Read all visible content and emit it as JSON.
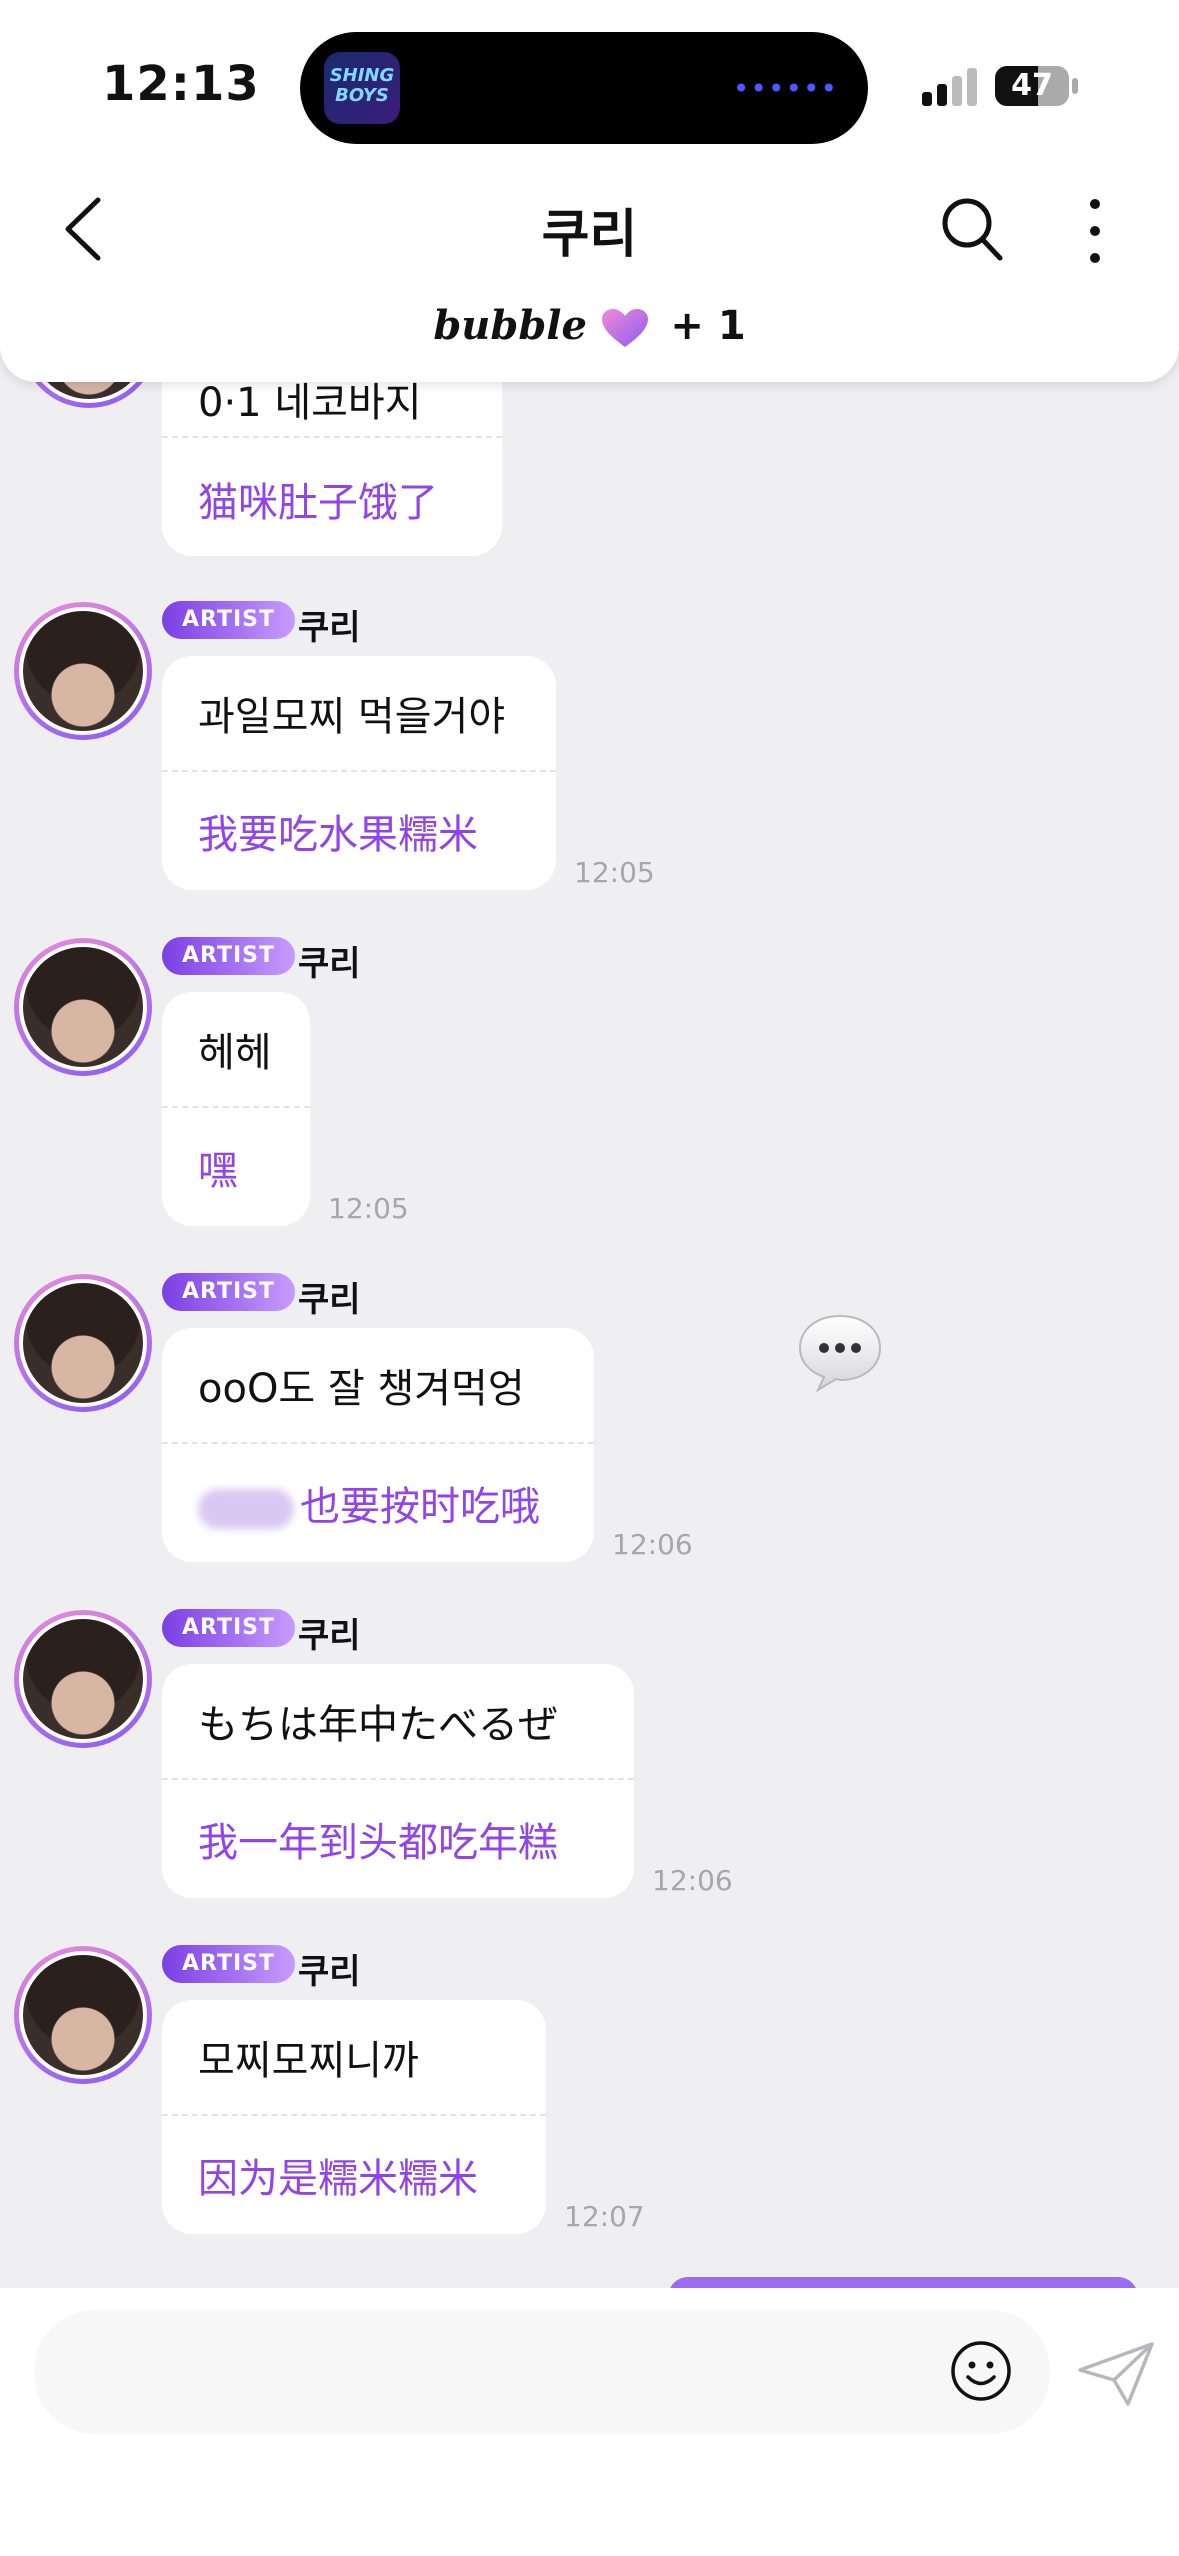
{
  "status_bar": {
    "time": "12:13",
    "battery": "47",
    "island_app": "SHING BOYS"
  },
  "header": {
    "title": "쿠리",
    "bubble_label": "bubble",
    "plus_label": "+ 1"
  },
  "top_partial": {
    "ko": "0·1 네코바지",
    "zh": "猫咪肚子饿了"
  },
  "messages": [
    {
      "badge": "ARTIST",
      "sender": "쿠리",
      "ko": "과일모찌 먹을거야",
      "zh": "我要吃水果糯米",
      "time": "12:05"
    },
    {
      "badge": "ARTIST",
      "sender": "쿠리",
      "ko": "헤헤",
      "zh": "嘿",
      "time": "12:05"
    },
    {
      "badge": "ARTIST",
      "sender": "쿠리",
      "ko": "ooO도 잘 챙겨먹엉",
      "zh": "也要按时吃哦",
      "time": "12:06"
    },
    {
      "badge": "ARTIST",
      "sender": "쿠리",
      "ko": "もちは年中たべるぜ",
      "zh": "我一年到头都吃年糕",
      "time": "12:06"
    },
    {
      "badge": "ARTIST",
      "sender": "쿠리",
      "ko": "모찌모찌니까",
      "zh": "因为是糯米糯米",
      "time": "12:07"
    }
  ],
  "input": {
    "placeholder": ""
  },
  "icons": {
    "back": "chevron-left-icon",
    "search": "search-icon",
    "more": "more-vertical-icon",
    "heart": "heart-icon",
    "emoji": "smiley-icon",
    "send": "paper-plane-icon",
    "float": "speech-bubble-icon"
  },
  "colors": {
    "accent": "#9145e6",
    "badge_start": "#7b3fe4",
    "badge_end": "#c79bff",
    "background": "#efeff1"
  }
}
